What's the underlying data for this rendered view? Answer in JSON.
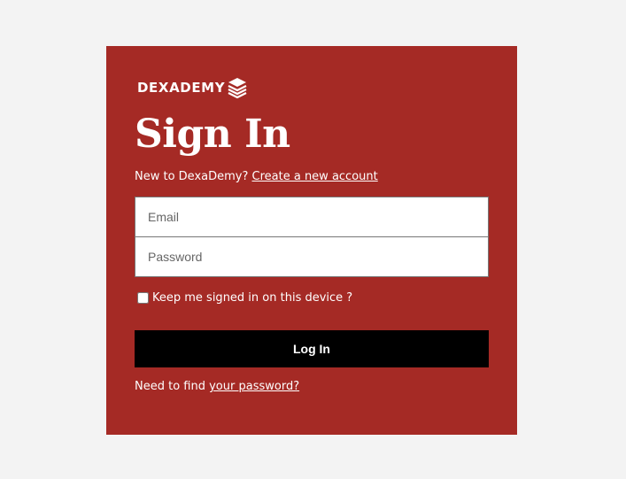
{
  "brand": {
    "logo_text": "DEXADEMY",
    "logo_icon": "stacked-books-icon"
  },
  "form": {
    "title": "Sign In",
    "signup_prompt": "New to DexaDemy?",
    "signup_link": "Create a new account",
    "email_placeholder": "Email",
    "email_value": "",
    "password_placeholder": "Password",
    "password_value": "",
    "remember_label": "Keep me signed in on this device ?",
    "remember_checked": false,
    "login_label": "Log In",
    "forgot_prompt": "Need to find",
    "forgot_link": "your password?"
  },
  "colors": {
    "page_background": "#f3f3f3",
    "card_background": "#a52a25",
    "button_background": "#000000",
    "text": "#ffffff"
  }
}
